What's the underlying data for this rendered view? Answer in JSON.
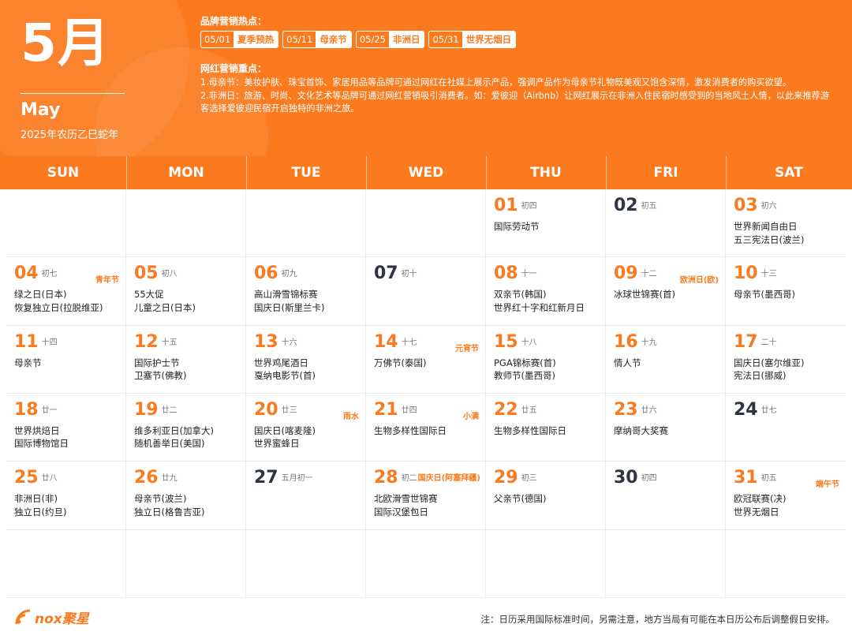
{
  "header": {
    "month": "5月",
    "month_en": "May",
    "lunar_year": "2025年农历乙巳蛇年",
    "hot_title": "品牌营销热点：",
    "hot_tags": [
      {
        "date": "05/01",
        "name": "夏季预热"
      },
      {
        "date": "05/11",
        "name": "母亲节"
      },
      {
        "date": "05/25",
        "name": "非洲日"
      },
      {
        "date": "05/31",
        "name": "世界无烟日"
      }
    ],
    "kol_title": "网红营销重点：",
    "kol_notes": [
      "1.母亲节：美妆护肤、珠宝首饰、家居用品等品牌可通过网红在社媒上展示产品，强调产品作为母亲节礼物既美观又饱含深情，激发消费者的购买欲望。",
      "2.非洲日：旅游、时尚、文化艺术等品牌可通过网红营销吸引消费者。如：爱彼迎（Airbnb）让网红展示在非洲入住民宿时感受到的当地风土人情，以此来推荐游客选择爱彼迎民宿开启独特的非洲之旅。"
    ]
  },
  "weekdays": [
    "SUN",
    "MON",
    "TUE",
    "WED",
    "THU",
    "FRI",
    "SAT"
  ],
  "cells": [
    null,
    null,
    null,
    null,
    {
      "day": "01",
      "lunar": "初四",
      "events": [
        "国际劳动节"
      ]
    },
    {
      "day": "02",
      "lunar": "初五",
      "dark": true,
      "events": []
    },
    {
      "day": "03",
      "lunar": "初六",
      "events": [
        "世界新闻自由日",
        "五三宪法日(波兰)"
      ]
    },
    {
      "day": "04",
      "lunar": "初七",
      "tag": "青年节",
      "events": [
        "绿之日(日本)",
        "恢复独立日(拉脱维亚)"
      ]
    },
    {
      "day": "05",
      "lunar": "初八",
      "events": [
        "55大促",
        "儿童之日(日本)"
      ]
    },
    {
      "day": "06",
      "lunar": "初九",
      "events": [
        "高山滑雪锦标赛",
        "国庆日(斯里兰卡)"
      ]
    },
    {
      "day": "07",
      "lunar": "初十",
      "dark": true,
      "events": []
    },
    {
      "day": "08",
      "lunar": "十一",
      "events": [
        "双亲节(韩国)",
        "世界红十字和红新月日"
      ]
    },
    {
      "day": "09",
      "lunar": "十二",
      "tag": "欧洲日(欧)",
      "events": [
        "冰球世锦赛(首)"
      ]
    },
    {
      "day": "10",
      "lunar": "十三",
      "events": [
        "母亲节(墨西哥)"
      ]
    },
    {
      "day": "11",
      "lunar": "十四",
      "events": [
        "母亲节"
      ]
    },
    {
      "day": "12",
      "lunar": "十五",
      "events": [
        "国际护士节",
        "卫塞节(佛教)"
      ]
    },
    {
      "day": "13",
      "lunar": "十六",
      "events": [
        "世界鸡尾酒日",
        "戛纳电影节(首)"
      ]
    },
    {
      "day": "14",
      "lunar": "十七",
      "tag": "元宵节",
      "events": [
        "万佛节(泰国)"
      ]
    },
    {
      "day": "15",
      "lunar": "十八",
      "events": [
        "PGA锦标赛(首)",
        "教师节(墨西哥)"
      ]
    },
    {
      "day": "16",
      "lunar": "十九",
      "events": [
        "情人节"
      ]
    },
    {
      "day": "17",
      "lunar": "二十",
      "events": [
        "国庆日(塞尔维亚)",
        "宪法日(挪威)"
      ]
    },
    {
      "day": "18",
      "lunar": "廿一",
      "events": [
        "世界烘焙日",
        "国际博物馆日"
      ]
    },
    {
      "day": "19",
      "lunar": "廿二",
      "events": [
        "维多利亚日(加拿大)",
        "随机善举日(美国)"
      ]
    },
    {
      "day": "20",
      "lunar": "廿三",
      "tag": "雨水",
      "events": [
        "国庆日(喀麦隆)",
        "世界蜜蜂日"
      ]
    },
    {
      "day": "21",
      "lunar": "廿四",
      "tag": "小满",
      "events": [
        "生物多样性国际日"
      ]
    },
    {
      "day": "22",
      "lunar": "廿五",
      "events": [
        "生物多样性国际日"
      ]
    },
    {
      "day": "23",
      "lunar": "廿六",
      "events": [
        "摩纳哥大奖赛"
      ]
    },
    {
      "day": "24",
      "lunar": "廿七",
      "dark": true,
      "events": []
    },
    {
      "day": "25",
      "lunar": "廿八",
      "events": [
        "非洲日(非)",
        "独立日(约旦)"
      ]
    },
    {
      "day": "26",
      "lunar": "廿九",
      "events": [
        "母亲节(波兰)",
        "独立日(格鲁吉亚)"
      ]
    },
    {
      "day": "27",
      "lunar": "五月初一",
      "dark": true,
      "events": []
    },
    {
      "day": "28",
      "lunar": "初二",
      "lunar_extra": "国庆日(阿塞拜疆)",
      "events": [
        "北欧滑雪世锦赛",
        "国际汉堡包日"
      ]
    },
    {
      "day": "29",
      "lunar": "初三",
      "events": [
        "父亲节(德国)"
      ]
    },
    {
      "day": "30",
      "lunar": "初四",
      "dark": true,
      "events": []
    },
    {
      "day": "31",
      "lunar": "初五",
      "tag": "端午节",
      "events": [
        "欧冠联赛(决)",
        "世界无烟日"
      ]
    },
    null,
    null,
    null,
    null,
    null,
    null,
    null
  ],
  "footer": {
    "logo_text": "nox聚星",
    "note": "注：日历采用国际标准时间，另需注意，地方当局有可能在本日历公布后调整假日安排。"
  },
  "colors": {
    "accent": "#fb7a1e",
    "dark_day": "#2e3440"
  }
}
